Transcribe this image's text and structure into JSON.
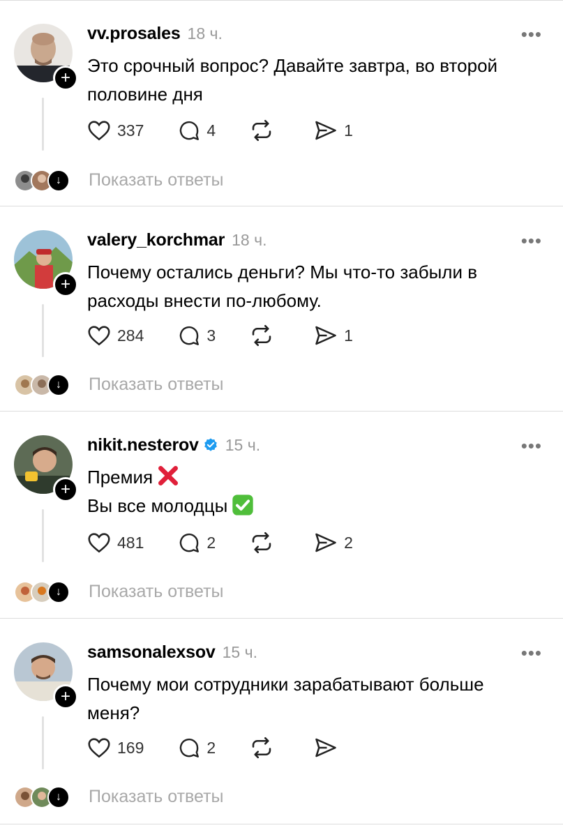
{
  "posts": [
    {
      "username": "vv.prosales",
      "time": "18 ч.",
      "verified": false,
      "lines": [
        "Это срочный вопрос? Давайте завтра, во второй",
        "половине дня"
      ],
      "likes": "337",
      "comments": "4",
      "shares": "1",
      "show_replies": "Показать ответы"
    },
    {
      "username": "valery_korchmar",
      "time": "18 ч.",
      "verified": false,
      "lines": [
        "Почему остались деньги? Мы что-то забыли в",
        "расходы внести по-любому."
      ],
      "likes": "284",
      "comments": "3",
      "shares": "1",
      "show_replies": "Показать ответы"
    },
    {
      "username": "nikit.nesterov",
      "time": "15 ч.",
      "verified": true,
      "lines": [
        "Премия",
        "Вы все молодцы"
      ],
      "likes": "481",
      "comments": "2",
      "shares": "2",
      "show_replies": "Показать ответы"
    },
    {
      "username": "samsonalexsov",
      "time": "15 ч.",
      "verified": false,
      "lines": [
        "Почему мои сотрудники зарабатывают больше",
        "меня?"
      ],
      "likes": "169",
      "comments": "2",
      "shares": "",
      "show_replies": "Показать ответы"
    }
  ],
  "icons": {
    "like": "heart-icon",
    "comment": "comment-icon",
    "repost": "repost-icon",
    "share": "send-icon",
    "more": "more-icon",
    "follow": "plus-icon",
    "verified": "verified-badge-icon"
  },
  "colors": {
    "accent_verified": "#1d9bf0",
    "muted": "#a8a8a8"
  }
}
